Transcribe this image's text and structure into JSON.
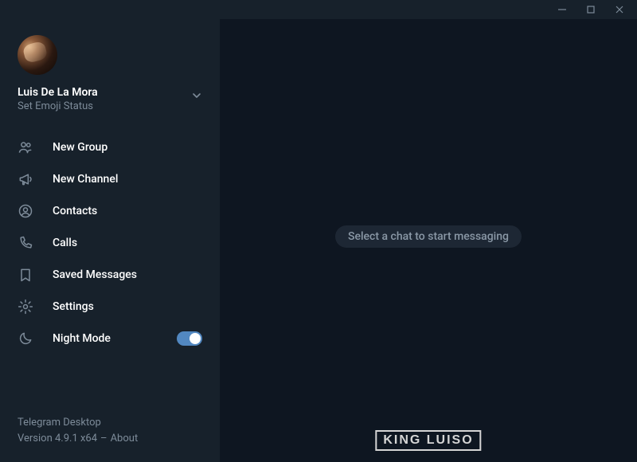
{
  "user": {
    "name": "Luis De La Mora",
    "status": "Set Emoji Status"
  },
  "menu": {
    "items": [
      {
        "label": "New Group"
      },
      {
        "label": "New Channel"
      },
      {
        "label": "Contacts"
      },
      {
        "label": "Calls"
      },
      {
        "label": "Saved Messages"
      },
      {
        "label": "Settings"
      },
      {
        "label": "Night Mode"
      }
    ]
  },
  "footer": {
    "app": "Telegram Desktop",
    "version": "Version 4.9.1 x64",
    "sep": "–",
    "about": "About"
  },
  "main": {
    "placeholder": "Select a chat to start messaging"
  },
  "watermark": "KING LUISO"
}
